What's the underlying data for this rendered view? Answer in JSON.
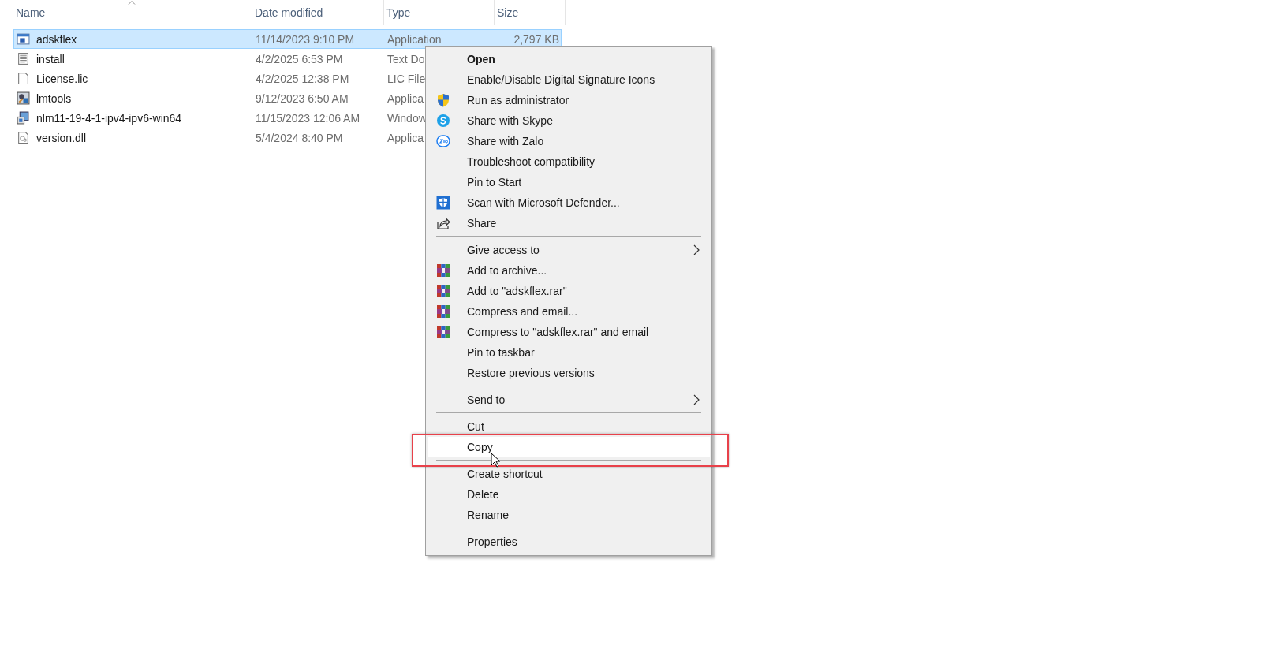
{
  "file_list": {
    "columns": [
      {
        "label": "Name",
        "sorted": true
      },
      {
        "label": "Date modified",
        "sorted": false
      },
      {
        "label": "Type",
        "sorted": false
      },
      {
        "label": "Size",
        "sorted": false
      }
    ],
    "rows": [
      {
        "name": "adskflex",
        "date": "11/14/2023 9:10 PM",
        "type": "Application",
        "size": "2,797 KB",
        "selected": true
      },
      {
        "name": "install",
        "date": "4/2/2025 6:53 PM",
        "type": "Text Do",
        "selected": false
      },
      {
        "name": "License.lic",
        "date": "4/2/2025 12:38 PM",
        "type": "LIC File",
        "selected": false
      },
      {
        "name": "lmtools",
        "date": "9/12/2023 6:50 AM",
        "type": "Applica",
        "selected": false
      },
      {
        "name": "nlm11-19-4-1-ipv4-ipv6-win64",
        "date": "11/15/2023 12:06 AM",
        "type": "Window",
        "selected": false
      },
      {
        "name": "version.dll",
        "date": "5/4/2024 8:40 PM",
        "type": "Applica",
        "selected": false
      }
    ]
  },
  "context_menu": {
    "items": [
      {
        "kind": "item",
        "label": "Open",
        "bold": true,
        "highlighted": false
      },
      {
        "kind": "item",
        "label": "Enable/Disable Digital Signature Icons",
        "highlighted": false
      },
      {
        "kind": "item",
        "label": "Run as administrator",
        "highlighted": false
      },
      {
        "kind": "item",
        "label": "Share with Skype",
        "highlighted": false
      },
      {
        "kind": "item",
        "label": "Share with Zalo",
        "highlighted": false
      },
      {
        "kind": "item",
        "label": "Troubleshoot compatibility",
        "highlighted": false
      },
      {
        "kind": "item",
        "label": "Pin to Start",
        "highlighted": false
      },
      {
        "kind": "item",
        "label": "Scan with Microsoft Defender...",
        "highlighted": false
      },
      {
        "kind": "item",
        "label": "Share",
        "highlighted": false
      },
      {
        "kind": "separator"
      },
      {
        "kind": "submenu",
        "label": "Give access to",
        "highlighted": false
      },
      {
        "kind": "item",
        "label": "Add to archive...",
        "highlighted": false
      },
      {
        "kind": "item",
        "label": "Add to \"adskflex.rar\"",
        "highlighted": false
      },
      {
        "kind": "item",
        "label": "Compress and email...",
        "highlighted": false
      },
      {
        "kind": "item",
        "label": "Compress to \"adskflex.rar\" and email",
        "highlighted": false
      },
      {
        "kind": "item",
        "label": "Pin to taskbar",
        "highlighted": false
      },
      {
        "kind": "item",
        "label": "Restore previous versions",
        "highlighted": false
      },
      {
        "kind": "separator"
      },
      {
        "kind": "submenu",
        "label": "Send to",
        "highlighted": false
      },
      {
        "kind": "separator"
      },
      {
        "kind": "item",
        "label": "Cut",
        "highlighted": false
      },
      {
        "kind": "item",
        "label": "Copy",
        "highlighted": true,
        "annotated": true
      },
      {
        "kind": "separator"
      },
      {
        "kind": "item",
        "label": "Create shortcut",
        "highlighted": false
      },
      {
        "kind": "item",
        "label": "Delete",
        "highlighted": false
      },
      {
        "kind": "item",
        "label": "Rename",
        "highlighted": false
      },
      {
        "kind": "separator"
      },
      {
        "kind": "item",
        "label": "Properties",
        "highlighted": false
      }
    ]
  }
}
